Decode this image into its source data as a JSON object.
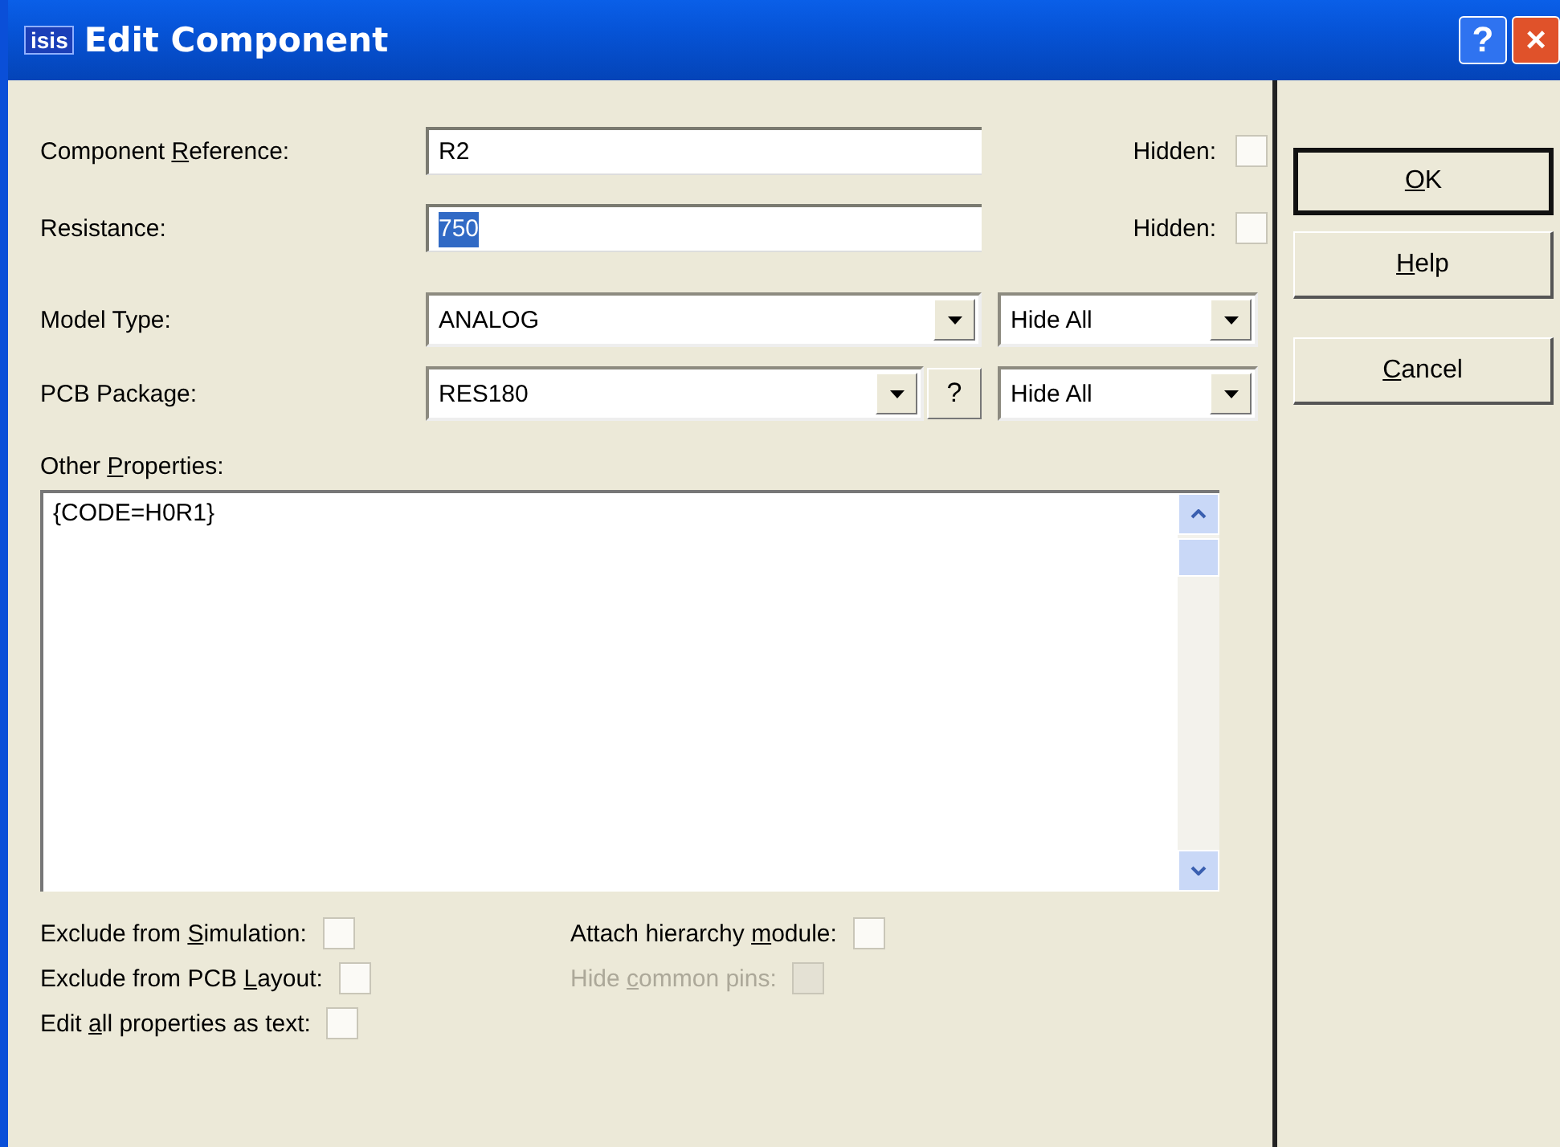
{
  "window": {
    "logo": "isis",
    "title": "Edit Component",
    "controls": [
      {
        "kind": "help",
        "label": "?"
      },
      {
        "kind": "close",
        "label": "×"
      }
    ]
  },
  "fields": [
    {
      "label": {
        "before": "Component ",
        "key": "R",
        "after": "eference:"
      },
      "value": "R2",
      "value_selected": false,
      "hidden_label": "Hidden:",
      "hidden_checked": false
    },
    {
      "label": {
        "before": "Resistance:"
      },
      "value": "750",
      "value_selected": true,
      "hidden_label": "Hidden:",
      "hidden_checked": false
    }
  ],
  "combos": [
    {
      "label": {
        "before": "Model Type:"
      },
      "value": "ANALOG",
      "visibility": "Hide All"
    },
    {
      "label": {
        "before": "PCB Package:"
      },
      "value": "RES180",
      "help_label": "?",
      "visibility": "Hide All"
    }
  ],
  "other_properties": {
    "label": {
      "before": "Other ",
      "key": "P",
      "after": "roperties:"
    },
    "text": "{CODE=H0R1}"
  },
  "options": [
    {
      "label": {
        "before": "Exclude from ",
        "key": "S",
        "after": "imulation:"
      },
      "checked": false,
      "disabled": false
    },
    {
      "label": {
        "before": "Attach hierarchy ",
        "key": "m",
        "after": "odule:"
      },
      "checked": false,
      "disabled": false
    },
    {
      "label": {
        "before": "Exclude from PCB ",
        "key": "L",
        "after": "ayout:"
      },
      "checked": false,
      "disabled": false
    },
    {
      "label": {
        "before": "Hide ",
        "key": "c",
        "after": "ommon pins:"
      },
      "checked": false,
      "disabled": true
    },
    {
      "label": {
        "before": "Edit ",
        "key": "a",
        "after": "ll properties as text:"
      },
      "checked": false,
      "disabled": false
    }
  ],
  "buttons": [
    {
      "label": {
        "key": "O",
        "after": "K"
      },
      "default": true
    },
    {
      "label": {
        "key": "H",
        "after": "elp"
      },
      "default": false
    },
    {
      "label": {
        "key": "C",
        "after": "ancel"
      },
      "default": false
    }
  ]
}
